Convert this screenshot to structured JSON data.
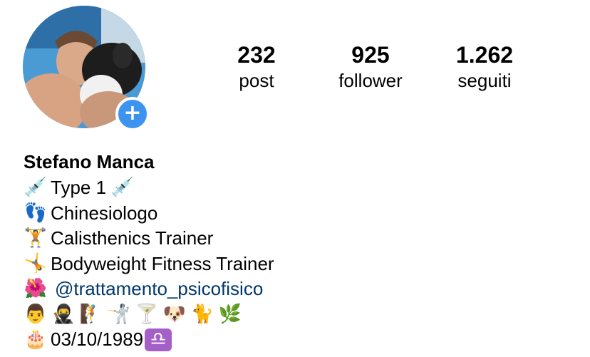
{
  "profile": {
    "add_story_symbol": "+",
    "avatar_icon": "avatar-photo-icon"
  },
  "stats": [
    {
      "count": "232",
      "label": "post"
    },
    {
      "count": "925",
      "label": "follower"
    },
    {
      "count": "1.262",
      "label": "seguiti"
    }
  ],
  "bio": {
    "name": "Stefano Manca",
    "lines": [
      {
        "emoji_before": "💉",
        "text": "Type 1",
        "emoji_after": "💉"
      },
      {
        "emoji_before": "👣",
        "text": "Chinesiologo"
      },
      {
        "emoji_before": "🏋",
        "text": "Calisthenics Trainer"
      },
      {
        "emoji_before": "🤸",
        "text": "Bodyweight Fitness Trainer"
      },
      {
        "emoji_before": "🌺",
        "mention": "@trattamento_psicofisico"
      }
    ],
    "emoji_row": [
      "👨",
      "🥷",
      "🧗",
      "🤺",
      "🍸",
      "🐶",
      "🐈",
      "🌿"
    ],
    "birthday": {
      "emoji": "🎂",
      "date": "03/10/1989",
      "zodiac": "♎"
    }
  },
  "colors": {
    "link": "#00376b",
    "add_button": "#3d93f0",
    "zodiac_badge": "#a560c8"
  }
}
